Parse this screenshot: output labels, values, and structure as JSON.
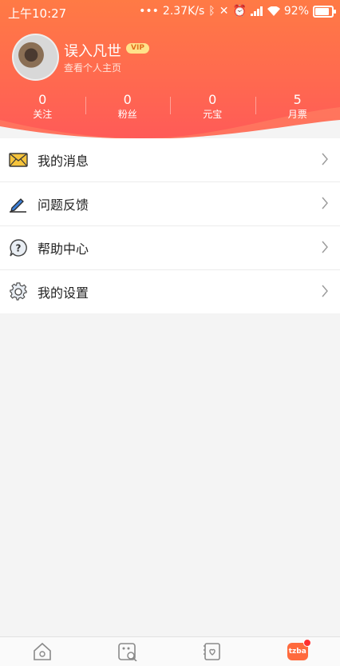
{
  "status_bar": {
    "time": "上午10:27",
    "network_speed": "2.37K/s",
    "battery": "92%"
  },
  "profile": {
    "username": "误入凡世",
    "vip_badge": "VIP",
    "profile_link": "查看个人主页"
  },
  "stats": [
    {
      "value": "0",
      "label": "关注"
    },
    {
      "value": "0",
      "label": "粉丝"
    },
    {
      "value": "0",
      "label": "元宝"
    },
    {
      "value": "5",
      "label": "月票"
    }
  ],
  "menu": [
    {
      "label": "我的消息",
      "icon": "envelope-icon"
    },
    {
      "label": "问题反馈",
      "icon": "pen-icon"
    },
    {
      "label": "帮助中心",
      "icon": "help-icon"
    },
    {
      "label": "我的设置",
      "icon": "gear-icon"
    }
  ],
  "tabbar": {
    "me_label": "tzba"
  },
  "colors": {
    "header_top": "#ff7a45",
    "header_bottom": "#ff5a58",
    "vip_bg": "#ffe28a"
  }
}
